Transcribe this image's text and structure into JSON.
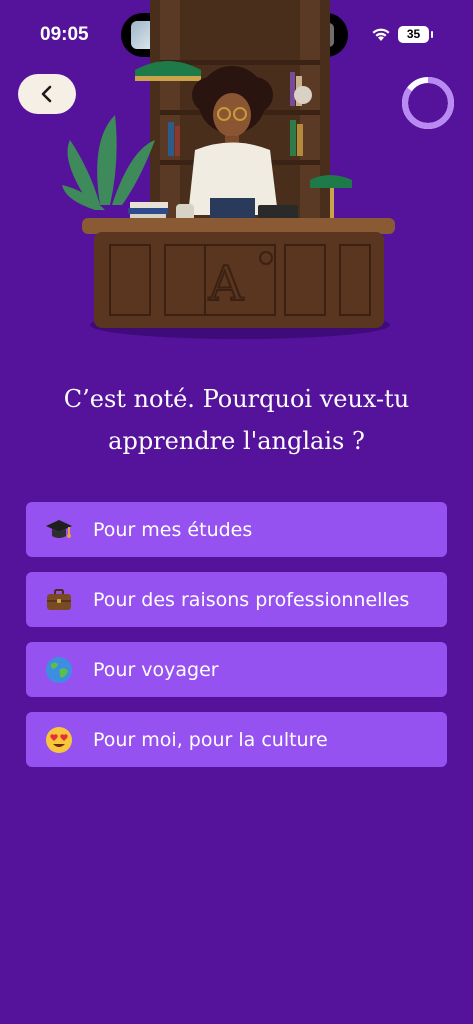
{
  "status_bar": {
    "time": "09:05",
    "battery_level": "35",
    "icons": [
      "wifi-icon",
      "battery-icon"
    ]
  },
  "header": {
    "back_icon": "chevron-left-icon",
    "progress_fraction": 0.85
  },
  "question": {
    "line1": "C’est noté. Pourquoi veux-tu",
    "line2": "apprendre l'anglais ?"
  },
  "options": [
    {
      "icon": "graduation-cap-icon",
      "label": "Pour mes études"
    },
    {
      "icon": "briefcase-icon",
      "label": "Pour des raisons professionnelles"
    },
    {
      "icon": "globe-icon",
      "label": "Pour voyager"
    },
    {
      "icon": "heart-eyes-face-icon",
      "label": "Pour moi, pour la culture"
    }
  ],
  "colors": {
    "background": "#54139a",
    "option_background": "#9652f0",
    "progress_ring": "#b98af2",
    "back_button": "#f6efe6"
  }
}
